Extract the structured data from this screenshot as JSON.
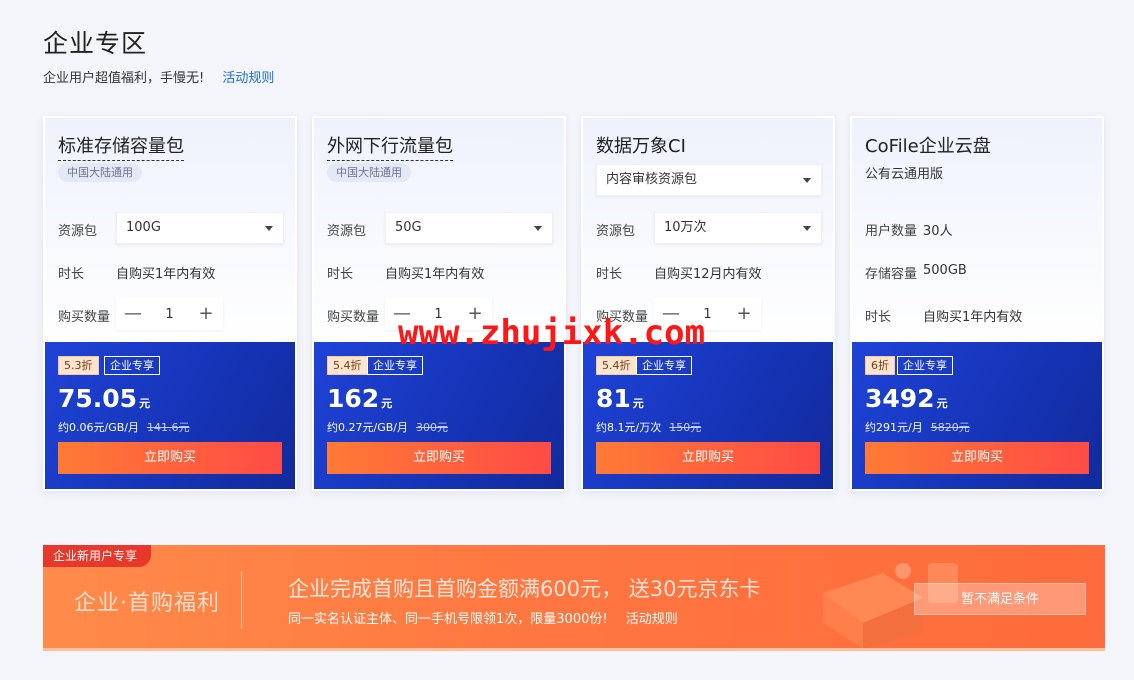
{
  "header": {
    "title": "企业专区",
    "subtitle": "企业用户超值福利，手慢无!",
    "rules_link": "活动规则"
  },
  "cards": [
    {
      "title": "标准存储容量包",
      "region_tag": "中国大陆通用",
      "package_label": "资源包",
      "package_value": "100G",
      "duration_label": "时长",
      "duration_value": "自购买1年内有效",
      "qty_label": "购买数量",
      "qty_minus": "—",
      "qty_value": "1",
      "qty_plus": "+",
      "discount": "5.3折",
      "enterprise_tag": "企业专享",
      "price": "75.05",
      "price_unit": "元",
      "unit_price": "约0.06元/GB/月",
      "original_price": "141.6元",
      "buy_label": "立即购买"
    },
    {
      "title": "外网下行流量包",
      "region_tag": "中国大陆通用",
      "package_label": "资源包",
      "package_value": "50G",
      "duration_label": "时长",
      "duration_value": "自购买1年内有效",
      "qty_label": "购买数量",
      "qty_minus": "—",
      "qty_value": "1",
      "qty_plus": "+",
      "discount": "5.4折",
      "enterprise_tag": "企业专享",
      "price": "162",
      "price_unit": "元",
      "unit_price": "约0.27元/GB/月",
      "original_price": "300元",
      "buy_label": "立即购买"
    },
    {
      "title": "数据万象CI",
      "type_select": "内容审核资源包",
      "package_label": "资源包",
      "package_value": "10万次",
      "duration_label": "时长",
      "duration_value": "自购买12月内有效",
      "qty_label": "购买数量",
      "qty_minus": "—",
      "qty_value": "1",
      "qty_plus": "+",
      "discount": "5.4折",
      "enterprise_tag": "企业专享",
      "price": "81",
      "price_unit": "元",
      "unit_price": "约8.1元/万次",
      "original_price": "150元",
      "buy_label": "立即购买"
    },
    {
      "title": "CoFile企业云盘",
      "edition": "公有云通用版",
      "users_label": "用户数量",
      "users_value": "30人",
      "storage_label": "存储容量",
      "storage_value": "500GB",
      "duration_label": "时长",
      "duration_value": "自购买1年内有效",
      "discount": "6折",
      "enterprise_tag": "企业专享",
      "price": "3492",
      "price_unit": "元",
      "unit_price": "约291元/月",
      "original_price": "5820元",
      "buy_label": "立即购买"
    }
  ],
  "watermark": "www.zhujixk.com",
  "banner": {
    "tag": "企业新用户专享",
    "left_title": "企业·首购福利",
    "headline": "企业完成首购且首购金额满600元， 送30元京东卡",
    "note": "同一实名认证主体、同一手机号限领1次，限量3000份!",
    "rules_link": "活动规则",
    "button": "暂不满足条件"
  },
  "colors": {
    "accent_blue": "#1f43d8",
    "buy_gradient_start": "#ff7a35",
    "buy_gradient_end": "#ff4b45",
    "link_blue": "#1f6fe0",
    "banner_orange": "#ff7740"
  }
}
